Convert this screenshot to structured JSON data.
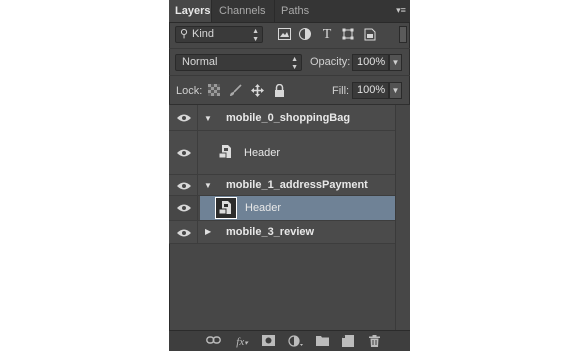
{
  "tabs": [
    {
      "label": "Layers",
      "active": true
    },
    {
      "label": "Channels",
      "active": false
    },
    {
      "label": "Paths",
      "active": false
    }
  ],
  "filter": {
    "kind_label": "Kind",
    "icons": [
      "image-filter-icon",
      "adjustment-filter-icon",
      "type-filter-icon",
      "shape-filter-icon",
      "smart-object-filter-icon"
    ]
  },
  "blend": {
    "mode": "Normal",
    "opacity_label": "Opacity:",
    "opacity_value": "100%"
  },
  "lock": {
    "label": "Lock:",
    "fill_label": "Fill:",
    "fill_value": "100%"
  },
  "layers": [
    {
      "name": "mobile_0_shoppingBag",
      "type": "group",
      "expanded": true
    },
    {
      "name": "Header",
      "type": "smart-object",
      "selected": false
    },
    {
      "name": "mobile_1_addressPayment",
      "type": "group",
      "expanded": true
    },
    {
      "name": "Header",
      "type": "smart-object",
      "selected": true
    },
    {
      "name": "mobile_3_review",
      "type": "group",
      "expanded": false
    }
  ],
  "colors": {
    "panel_bg": "#474747",
    "selected_row": "#6f8296",
    "text": "#e8e8e8"
  }
}
